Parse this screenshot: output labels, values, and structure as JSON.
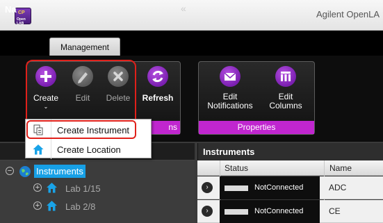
{
  "window": {
    "title": "Agilent OpenLA",
    "logo_text_top": "CP",
    "logo_text_bottom": "Open LAB"
  },
  "tabs": [
    {
      "label": "Management"
    }
  ],
  "ribbon": {
    "group_ops": {
      "label": "ns",
      "buttons": [
        {
          "label": "Create",
          "enabled": true,
          "icon": "plus-icon"
        },
        {
          "label": "Edit",
          "enabled": false,
          "icon": "pencil-icon"
        },
        {
          "label": "Delete",
          "enabled": false,
          "icon": "close-icon"
        },
        {
          "label": "Refresh",
          "enabled": true,
          "icon": "refresh-icon"
        }
      ]
    },
    "group_props": {
      "label": "Properties",
      "buttons": [
        {
          "label_line1": "Edit",
          "label_line2": "Notifications",
          "icon": "envelope-icon"
        },
        {
          "label_line1": "Edit",
          "label_line2": "Columns",
          "icon": "columns-icon"
        }
      ]
    }
  },
  "create_menu": {
    "items": [
      {
        "label": "Create Instrument",
        "icon": "instrument-icon"
      },
      {
        "label": "Create Location",
        "icon": "house-icon"
      }
    ]
  },
  "nav": {
    "title": "Na",
    "collapse_glyph": "«",
    "tree": {
      "root": {
        "label": "Instruments",
        "toggle": "−"
      },
      "children": [
        {
          "label": "Lab 1/15",
          "toggle": "+"
        },
        {
          "label": "Lab 2/8",
          "toggle": "+"
        }
      ]
    }
  },
  "grid": {
    "title": "Instruments",
    "columns": [
      "Status",
      "Name"
    ],
    "rows": [
      {
        "status": "NotConnected",
        "name": "ADC"
      },
      {
        "status": "NotConnected",
        "name": "CE"
      }
    ]
  },
  "colors": {
    "accent": "#c026cf",
    "highlight": "#e0201a",
    "selection": "#17a0e6"
  }
}
